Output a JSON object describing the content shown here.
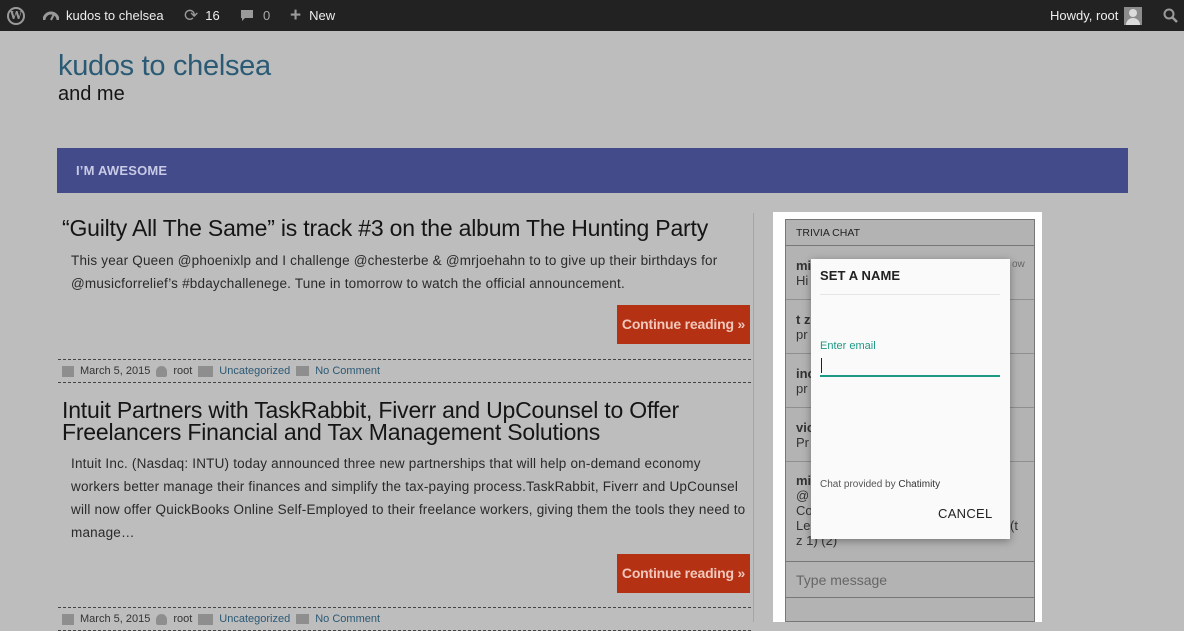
{
  "adminbar": {
    "site_name": "kudos to chelsea",
    "updates_count": "16",
    "comments_count": "0",
    "new_label": "New",
    "greeting": "Howdy, root"
  },
  "site": {
    "title": "kudos to chelsea",
    "tagline": "and me"
  },
  "nav": {
    "item": "I’M AWESOME"
  },
  "posts": [
    {
      "title": "“Guilty All The Same” is track #3 on the album The Hunting Party",
      "excerpt": "This year Queen @phoenixlp and I challenge @chesterbe & @mrjoehahn to to give up their birthdays for @musicforrelief’s #bdaychallenege. Tune in tomorrow to watch the official announcement.",
      "continue_label": "Continue reading »",
      "date": "March 5, 2015",
      "author": "root",
      "category": "Uncategorized",
      "comments": "No Comment"
    },
    {
      "title": "Intuit Partners with TaskRabbit, Fiverr and UpCounsel to Offer Freelancers Financial and Tax Management Solutions",
      "excerpt": "Intuit Inc. (Nasdaq: INTU) today announced three new partnerships that will help on-demand economy workers better manage their finances and simplify the tax-paying process.TaskRabbit, Fiverr and UpCounsel will now offer QuickBooks Online Self-Employed to their freelance workers, giving them the tools they need to manage…",
      "continue_label": "Continue reading »",
      "date": "March 5, 2015",
      "author": "root",
      "category": "Uncategorized",
      "comments": "No Comment"
    }
  ],
  "chat": {
    "header": "TRIVIA CHAT",
    "rows": [
      {
        "name": "mi",
        "text": "Hi",
        "time": "ow"
      },
      {
        "name": "t z",
        "text": "pr"
      },
      {
        "name": "inc",
        "text": "pr"
      },
      {
        "name": "vic",
        "text": "Pr"
      },
      {
        "name": "mi",
        "lines": [
          "@",
          "Co",
          "Le"
        ],
        "tail1": "(t",
        "tail2": "z 1) (2)"
      }
    ],
    "input_placeholder": "Type message"
  },
  "modal": {
    "title": "SET A NAME",
    "email_label": "Enter email",
    "email_value": "",
    "credit_prefix": "Chat provided by",
    "credit_brand": "Chatimity",
    "cancel_label": "CANCEL"
  },
  "colors": {
    "nav_bg": "#434b8a",
    "button_bg": "#b53114",
    "accent_teal": "#1e9984",
    "link": "#2b5a75"
  }
}
